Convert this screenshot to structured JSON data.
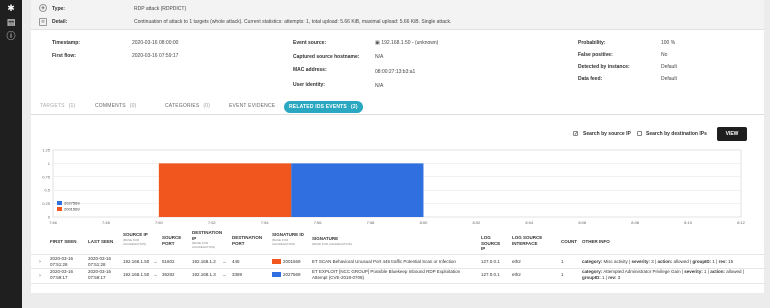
{
  "sidebar": {
    "icons": [
      "gear-icon",
      "document-icon",
      "info-icon"
    ],
    "glyphs": [
      "✱",
      "▤",
      "ⓘ"
    ]
  },
  "detail": {
    "type_label": "Type:",
    "type_value": "RDP attack (RDPDICT)",
    "detail_label": "Detail:",
    "detail_value": "Continuation of attack to 1 targets (whole attack). Current statistics: attempts: 1, total upload: 5.66 KiB, maximal upload: 5.66 KiB. Single attack."
  },
  "props": {
    "timestamp_label": "Timestamp:",
    "timestamp_value": "2020-03-16 08:00:00",
    "first_flow_label": "First flow:",
    "first_flow_value": "2020-03-16 07:59:17",
    "event_source_label": "Event source:",
    "event_source_value": "192.168.1.50 - (unknown)",
    "captured_label": "Captured source hostname:",
    "captured_value": "N/A",
    "mac_label": "MAC address:",
    "mac_value": "08:00:27:13:b3:a1",
    "user_label": "User identity:",
    "user_value": "N/A",
    "probability_label": "Probability:",
    "probability_value": "100 %",
    "false_positive_label": "False positive:",
    "false_positive_value": "No",
    "detected_label": "Detected by instance:",
    "detected_value": "Default",
    "datafeed_label": "Data feed:",
    "datafeed_value": "Default"
  },
  "tabs": [
    {
      "label": "TARGETS",
      "count": "(1)"
    },
    {
      "label": "COMMENTS",
      "count": "(0)"
    },
    {
      "label": "CATEGORIES",
      "count": "(0)"
    },
    {
      "label": "EVENT EVIDENCE",
      "count": ""
    },
    {
      "label": "RELATED IDS EVENTS",
      "count": "(2)"
    }
  ],
  "filters": {
    "by_source_label": "Search by source IP",
    "by_source_checked": "✓",
    "by_dest_label": "Search by destination IPs",
    "view_label": "VIEW"
  },
  "chart_data": {
    "type": "bar",
    "x_ticks": [
      "7:46",
      "7:48",
      "7:50",
      "7:52",
      "7:54",
      "7:56",
      "7:58",
      "8:00",
      "8:02",
      "8:04",
      "8:06",
      "8:08",
      "8:10",
      "8:12"
    ],
    "y_ticks": [
      "1.25",
      "1",
      "0.75",
      "0.5",
      "0.25",
      "0"
    ],
    "ylim": [
      0,
      1.25
    ],
    "series": [
      {
        "name": "2027569",
        "color": "#2f6fe0",
        "x_start": "7:55",
        "x_end": "8:00",
        "value": 1
      },
      {
        "name": "2001569",
        "color": "#f0561d",
        "x_start": "7:50",
        "x_end": "7:55",
        "value": 1
      }
    ]
  },
  "table": {
    "headers": {
      "first_seen": "FIRST SEEN",
      "last_seen": "LAST SEEN",
      "source_ip": "SOURCE IP",
      "source_ip_sub": "(BASE FOR AGGREGATION)",
      "source_port": "SOURCE PORT",
      "dest_ip": "DESTINATION IP",
      "dest_ip_sub": "(BASE FOR AGGREGATION)",
      "dest_port": "DESTINATION PORT",
      "sig_id": "SIGNATURE ID",
      "sig_id_sub": "(BASE FOR AGGREGATION)",
      "signature": "SIGNATURE",
      "signature_sub": "(BASE FOR AGGREGATION)",
      "log_source_ip": "LOG SOURCE IP",
      "log_source_iface": "LOG SOURCE INTERFACE",
      "count": "COUNT",
      "other_info": "OTHER INFO"
    },
    "rows": [
      {
        "first_seen": "2020-03-16 07:51:28",
        "last_seen": "2020-03-16 07:51:28",
        "source_ip": "192.168.1.50",
        "source_port": "51602",
        "dest_ip": "192.168.1.2",
        "dest_port": "445",
        "sig_id": "2001569",
        "sig_color": "#f0561d",
        "signature": "ET SCAN Behavioral Unusual Port 445 traffic Potential Scan or Infection",
        "log_source_ip": "127.0.0.1",
        "log_source_iface": "eth2",
        "count": "1",
        "other_info_prefix": "category:",
        "other_info_a": "Misc activity",
        "other_info_b": "severity:",
        "other_info_c": "3",
        "other_info_d": "action:",
        "other_info_e": "allowed",
        "other_info_f": "groupID:",
        "other_info_g": "1",
        "other_info_h": "rev:",
        "other_info_i": "15"
      },
      {
        "first_seen": "2020-03-16 07:59:17",
        "last_seen": "2020-03-16 07:59:17",
        "source_ip": "192.168.1.50",
        "source_port": "39282",
        "dest_ip": "192.168.1.3",
        "dest_port": "3389",
        "sig_id": "2027569",
        "sig_color": "#2f6fe0",
        "signature": "ET EXPLOIT [NCC GROUP] Possible Bluekeep Inbound RDP Exploitation Attempt (CVE-2019-0708)",
        "log_source_ip": "127.0.0.1",
        "log_source_iface": "eth2",
        "count": "1",
        "other_info_prefix": "category:",
        "other_info_a": "Attempted Administrator Privilege Gain",
        "other_info_b": "severity:",
        "other_info_c": "1",
        "other_info_d": "action:",
        "other_info_e": "allowed",
        "other_info_f": "groupID:",
        "other_info_g": "1",
        "other_info_h": "rev:",
        "other_info_i": "3"
      }
    ],
    "separator": "→"
  }
}
